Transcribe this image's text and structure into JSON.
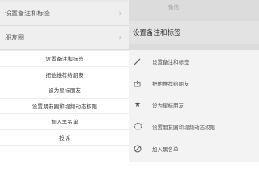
{
  "left": {
    "background_rows": [
      {
        "label": "设置备注和标签"
      },
      {
        "label": "朋友圈"
      }
    ],
    "sheet_items": [
      {
        "label": "设置备注和标签"
      },
      {
        "label": "把他推荐给朋友"
      },
      {
        "label": "设为星标朋友"
      },
      {
        "label": "设置朋友圈和视频动态权限"
      },
      {
        "label": "加入黑名单"
      },
      {
        "label": "投诉"
      }
    ]
  },
  "right": {
    "faint_top": "微信:",
    "background_row": {
      "label": "设置备注和标签"
    },
    "sheet_items": [
      {
        "label": "设置备注和标签",
        "icon": "edit-icon"
      },
      {
        "label": "把他推荐给朋友",
        "icon": "share-icon"
      },
      {
        "label": "设为星标朋友",
        "icon": "star-icon"
      },
      {
        "label": "设置朋友圈和视频动态权限",
        "icon": "moments-icon"
      },
      {
        "label": "加入黑名单",
        "icon": "block-icon"
      }
    ]
  }
}
